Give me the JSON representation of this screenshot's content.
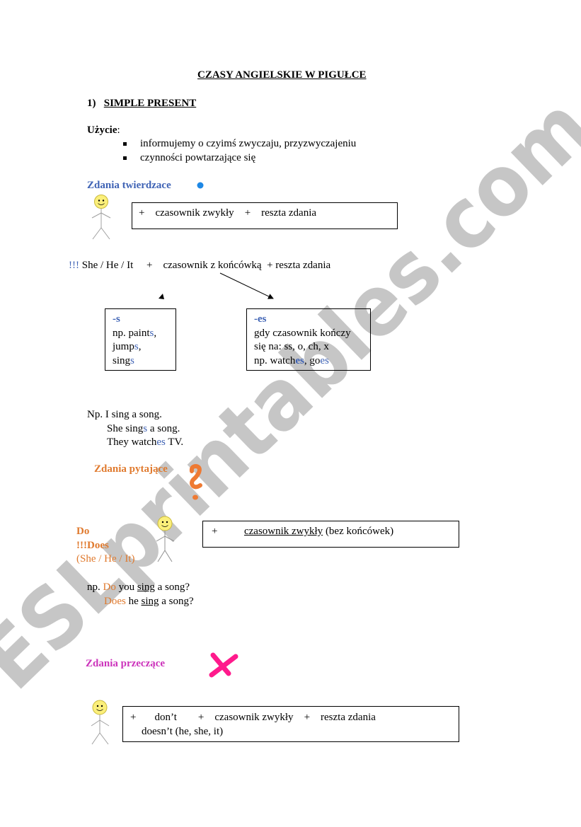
{
  "document": {
    "title": "CZASY ANGIELSKIE W PIGUŁCE",
    "section": {
      "number": "1)",
      "heading": "SIMPLE PRESENT"
    },
    "usage": {
      "label": "Użycie",
      "colon": ":",
      "bullets": [
        "informujemy o czyimś zwyczaju, przyzwyczajeniu",
        "czynności powtarzające się"
      ]
    },
    "affirmative": {
      "heading": "Zdania twierdzace",
      "formula": {
        "plus1": "+",
        "verb": "czasownik zwykły",
        "plus2": "+",
        "rest": "reszta zdania"
      },
      "third_person": {
        "exclaim": "!!!",
        "subjects": "She / He / It",
        "plus1": "+",
        "verb_ending": "czasownik z końcówką",
        "plus2": "+ reszta zdania"
      },
      "ending_s": {
        "label": "-s",
        "lines": [
          {
            "prefix": "np. paint",
            "ending": "s",
            "suffix": ","
          },
          {
            "prefix": "jump",
            "ending": "s",
            "suffix": ","
          },
          {
            "prefix": "sing",
            "ending": "s",
            "suffix": ""
          }
        ]
      },
      "ending_es": {
        "label": "-es",
        "line1": "gdy czasownik kończy",
        "line2": "się na: ss, o, ch, x",
        "example_prefix": "np. watch",
        "example_ending1": "es",
        "example_mid": ", go",
        "example_ending2": "es"
      },
      "examples": {
        "line1": "Np. I sing a song.",
        "line2_prefix": "She sing",
        "line2_ending": "s",
        "line2_suffix": " a song.",
        "line3_prefix": "They watch",
        "line3_ending": "es",
        "line3_suffix": " TV."
      }
    },
    "questions": {
      "heading": "Zdania pytające",
      "aux_do": "Do",
      "aux_does": "!!!Does",
      "aux_note": "(She / He / It)",
      "formula": {
        "plus": "+",
        "verb": "czasownik zwykły",
        "note": " (bez końcówek)"
      },
      "examples": {
        "line1_prefix": "np. ",
        "line1_aux": "Do",
        "line1_mid": " you ",
        "line1_verb": "sing",
        "line1_suffix": " a song?",
        "line2_aux": "Does",
        "line2_mid": " he ",
        "line2_verb": "sing",
        "line2_suffix": " a song?"
      }
    },
    "negatives": {
      "heading": "Zdania przeczące",
      "formula": {
        "plus1": "+",
        "dont": "don’t",
        "plus2": "+",
        "verb": "czasownik zwykły",
        "plus3": "+",
        "rest": "reszta zdania",
        "doesnt": "doesn’t (he, she, it)"
      }
    },
    "watermark": "ESLprintables.com"
  },
  "colors": {
    "affirmative": "#3f63b5",
    "question": "#e07a2e",
    "negative": "#cc33bb",
    "watermark": "#c4c4c4",
    "bullet_dot": "#1e88e5",
    "cross": "#ff1493"
  },
  "icons": {
    "affirmative_mark": "blue-dot-icon",
    "question_mark": "question-mark-icon",
    "negative_mark": "cross-x-icon",
    "person": "stick-figure-icon"
  }
}
